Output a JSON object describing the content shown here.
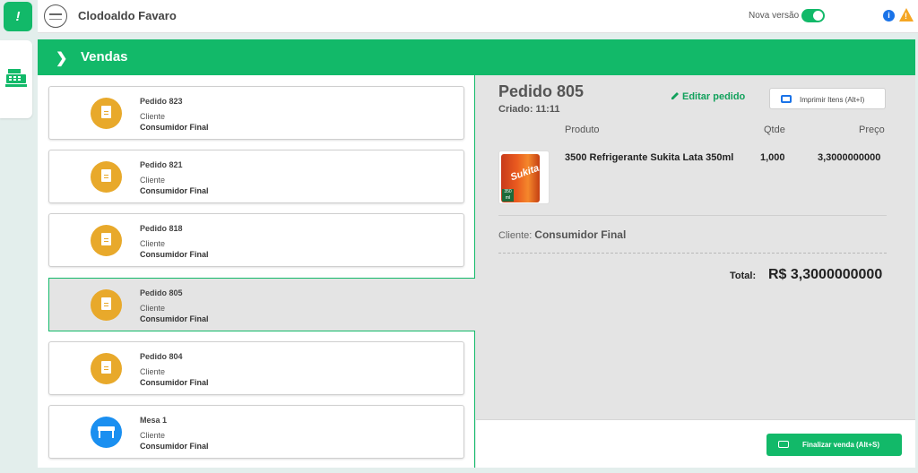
{
  "app": {
    "user_name": "Clodoaldo Favaro",
    "nova_versao_label": "Nova versão",
    "nova_versao_on": true,
    "accent_color": "#12b969"
  },
  "rail": {
    "top_icon": "exclamation-icon",
    "register_icon": "cash-register-icon"
  },
  "header": {
    "title": "Vendas",
    "chevron_icon": "chevron-right-icon"
  },
  "orders": [
    {
      "title": "Pedido 823",
      "client_label": "Cliente",
      "client": "Consumidor Final",
      "icon": "document-icon",
      "selected": false
    },
    {
      "title": "Pedido 821",
      "client_label": "Cliente",
      "client": "Consumidor Final",
      "icon": "document-icon",
      "selected": false
    },
    {
      "title": "Pedido 818",
      "client_label": "Cliente",
      "client": "Consumidor Final",
      "icon": "document-icon",
      "selected": false
    },
    {
      "title": "Pedido 805",
      "client_label": "Cliente",
      "client": "Consumidor Final",
      "icon": "document-icon",
      "selected": true
    },
    {
      "title": "Pedido 804",
      "client_label": "Cliente",
      "client": "Consumidor Final",
      "icon": "document-icon",
      "selected": false
    },
    {
      "title": "Mesa 1",
      "client_label": "Cliente",
      "client": "Consumidor Final",
      "icon": "table-icon",
      "selected": false
    }
  ],
  "detail": {
    "title": "Pedido 805",
    "created": "Criado: 11:11",
    "edit_label": "Editar pedido",
    "print_label": "Imprimir Itens (Alt+I)",
    "columns": {
      "product": "Produto",
      "qty": "Qtde",
      "price": "Preço"
    },
    "items": [
      {
        "name": "3500 Refrigerante Sukita Lata 350ml",
        "qty": "1,000",
        "price": "3,3000000000",
        "image_brand": "Sukita",
        "image_size": "350 ml"
      }
    ],
    "client_label": "Cliente:",
    "client": "Consumidor Final",
    "total_label": "Total:",
    "total_value": "R$ 3,3000000000"
  },
  "footer": {
    "finalize_label": "Finalizar venda (Alt+S)"
  }
}
